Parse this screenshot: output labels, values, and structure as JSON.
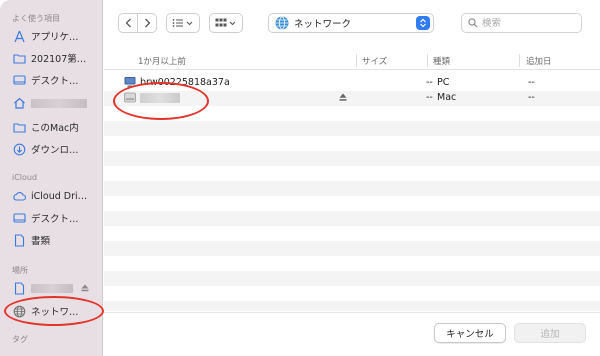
{
  "sidebar": {
    "favorites_title": "よく使う項目",
    "favorites": [
      {
        "label": "アプリケ…",
        "icon": "applications-icon"
      },
      {
        "label": "202107第…",
        "icon": "folder-icon"
      },
      {
        "label": "デスクト…",
        "icon": "desktop-icon"
      },
      {
        "label": "",
        "icon": "home-icon"
      },
      {
        "label": "このMac内",
        "icon": "folder-icon"
      },
      {
        "label": "ダウンロ…",
        "icon": "download-icon"
      }
    ],
    "icloud_title": "iCloud",
    "icloud": [
      {
        "label": "iCloud Dri…",
        "icon": "icloud-icon"
      },
      {
        "label": "デスクト…",
        "icon": "desktop-icon"
      },
      {
        "label": "書類",
        "icon": "document-icon"
      }
    ],
    "locations_title": "場所",
    "locations": [
      {
        "label": "",
        "icon": "document-icon"
      },
      {
        "label": "ネットワ…",
        "icon": "network-icon"
      }
    ],
    "tags_title": "タグ"
  },
  "toolbar": {
    "location": "ネットワーク",
    "search_placeholder": "検索"
  },
  "table": {
    "headers": {
      "name": "1か月以上前",
      "size": "サイズ",
      "kind": "種類",
      "added": "追加日"
    },
    "rows": [
      {
        "name": "brw00225818a37a",
        "size": "--",
        "kind": "PC",
        "added": "--"
      },
      {
        "name": "",
        "size": "--",
        "kind": "Mac",
        "added": "--"
      }
    ]
  },
  "footer": {
    "cancel": "キャンセル",
    "add": "追加"
  },
  "colors": {
    "sidebar_bg": "#e7dfe3",
    "accent": "#2f7cf6",
    "annotation": "#e3332a"
  }
}
